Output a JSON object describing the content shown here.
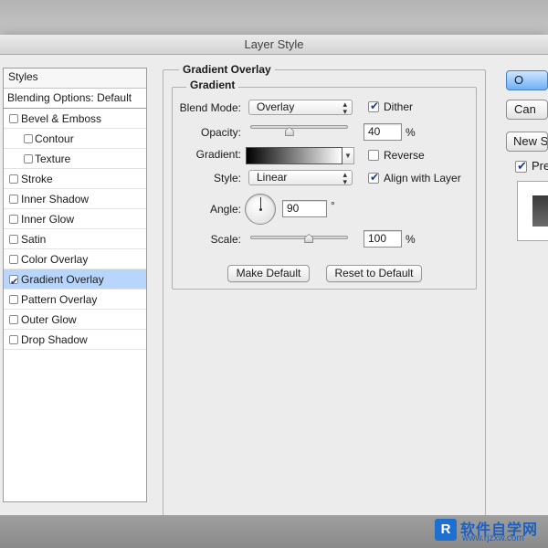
{
  "window": {
    "title": "Layer Style"
  },
  "styles_panel": {
    "header": "Styles",
    "blending_options": "Blending Options: Default",
    "items": [
      {
        "label": "Bevel & Emboss",
        "checked": false,
        "indent": false,
        "selected": false
      },
      {
        "label": "Contour",
        "checked": false,
        "indent": true,
        "selected": false
      },
      {
        "label": "Texture",
        "checked": false,
        "indent": true,
        "selected": false
      },
      {
        "label": "Stroke",
        "checked": false,
        "indent": false,
        "selected": false
      },
      {
        "label": "Inner Shadow",
        "checked": false,
        "indent": false,
        "selected": false
      },
      {
        "label": "Inner Glow",
        "checked": false,
        "indent": false,
        "selected": false
      },
      {
        "label": "Satin",
        "checked": false,
        "indent": false,
        "selected": false
      },
      {
        "label": "Color Overlay",
        "checked": false,
        "indent": false,
        "selected": false
      },
      {
        "label": "Gradient Overlay",
        "checked": true,
        "indent": false,
        "selected": true
      },
      {
        "label": "Pattern Overlay",
        "checked": false,
        "indent": false,
        "selected": false
      },
      {
        "label": "Outer Glow",
        "checked": false,
        "indent": false,
        "selected": false
      },
      {
        "label": "Drop Shadow",
        "checked": false,
        "indent": false,
        "selected": false
      }
    ]
  },
  "gradient_overlay": {
    "title": "Gradient Overlay",
    "section_title": "Gradient",
    "blend_mode_label": "Blend Mode:",
    "blend_mode_value": "Overlay",
    "dither_label": "Dither",
    "dither_checked": true,
    "opacity_label": "Opacity:",
    "opacity_value": "40",
    "opacity_fraction": 0.4,
    "opacity_unit": "%",
    "gradient_label": "Gradient:",
    "gradient_colors": [
      "#000000",
      "#ffffff"
    ],
    "reverse_label": "Reverse",
    "reverse_checked": false,
    "style_label": "Style:",
    "style_value": "Linear",
    "align_label": "Align with Layer",
    "align_checked": true,
    "angle_label": "Angle:",
    "angle_value": "90",
    "angle_unit": "°",
    "scale_label": "Scale:",
    "scale_value": "100",
    "scale_fraction": 0.6,
    "scale_unit": "%",
    "make_default": "Make Default",
    "reset_default": "Reset to Default"
  },
  "side_buttons": {
    "ok": "O",
    "cancel": "Can",
    "new_style": "New S",
    "preview_label": "Pre",
    "preview_checked": true
  },
  "watermark": {
    "logo": "R",
    "title": "软件自学网",
    "url": "www.rjzxw.com"
  },
  "colors": {
    "selection": "#b8d6fb",
    "primary_button": "#6fb0f6",
    "window_bg": "#ececec"
  }
}
